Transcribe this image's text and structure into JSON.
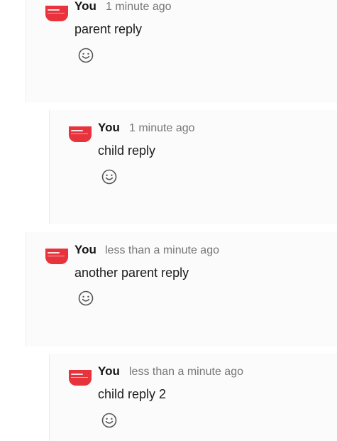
{
  "comments": [
    {
      "level": "parent",
      "author": "You",
      "time": "1 minute ago",
      "body": "parent reply",
      "reaction_icon": "smiley-icon"
    },
    {
      "level": "child",
      "author": "You",
      "time": "1 minute ago",
      "body": "child reply",
      "reaction_icon": "smiley-icon"
    },
    {
      "level": "parent",
      "author": "You",
      "time": "less than a minute ago",
      "body": "another parent reply",
      "reaction_icon": "smiley-icon"
    },
    {
      "level": "child",
      "author": "You",
      "time": "less than a minute ago",
      "body": "child reply 2",
      "reaction_icon": "smiley-icon"
    }
  ],
  "colors": {
    "avatar": "#e8323c",
    "card_background": "#fbfbfb",
    "muted_text": "#767676"
  }
}
